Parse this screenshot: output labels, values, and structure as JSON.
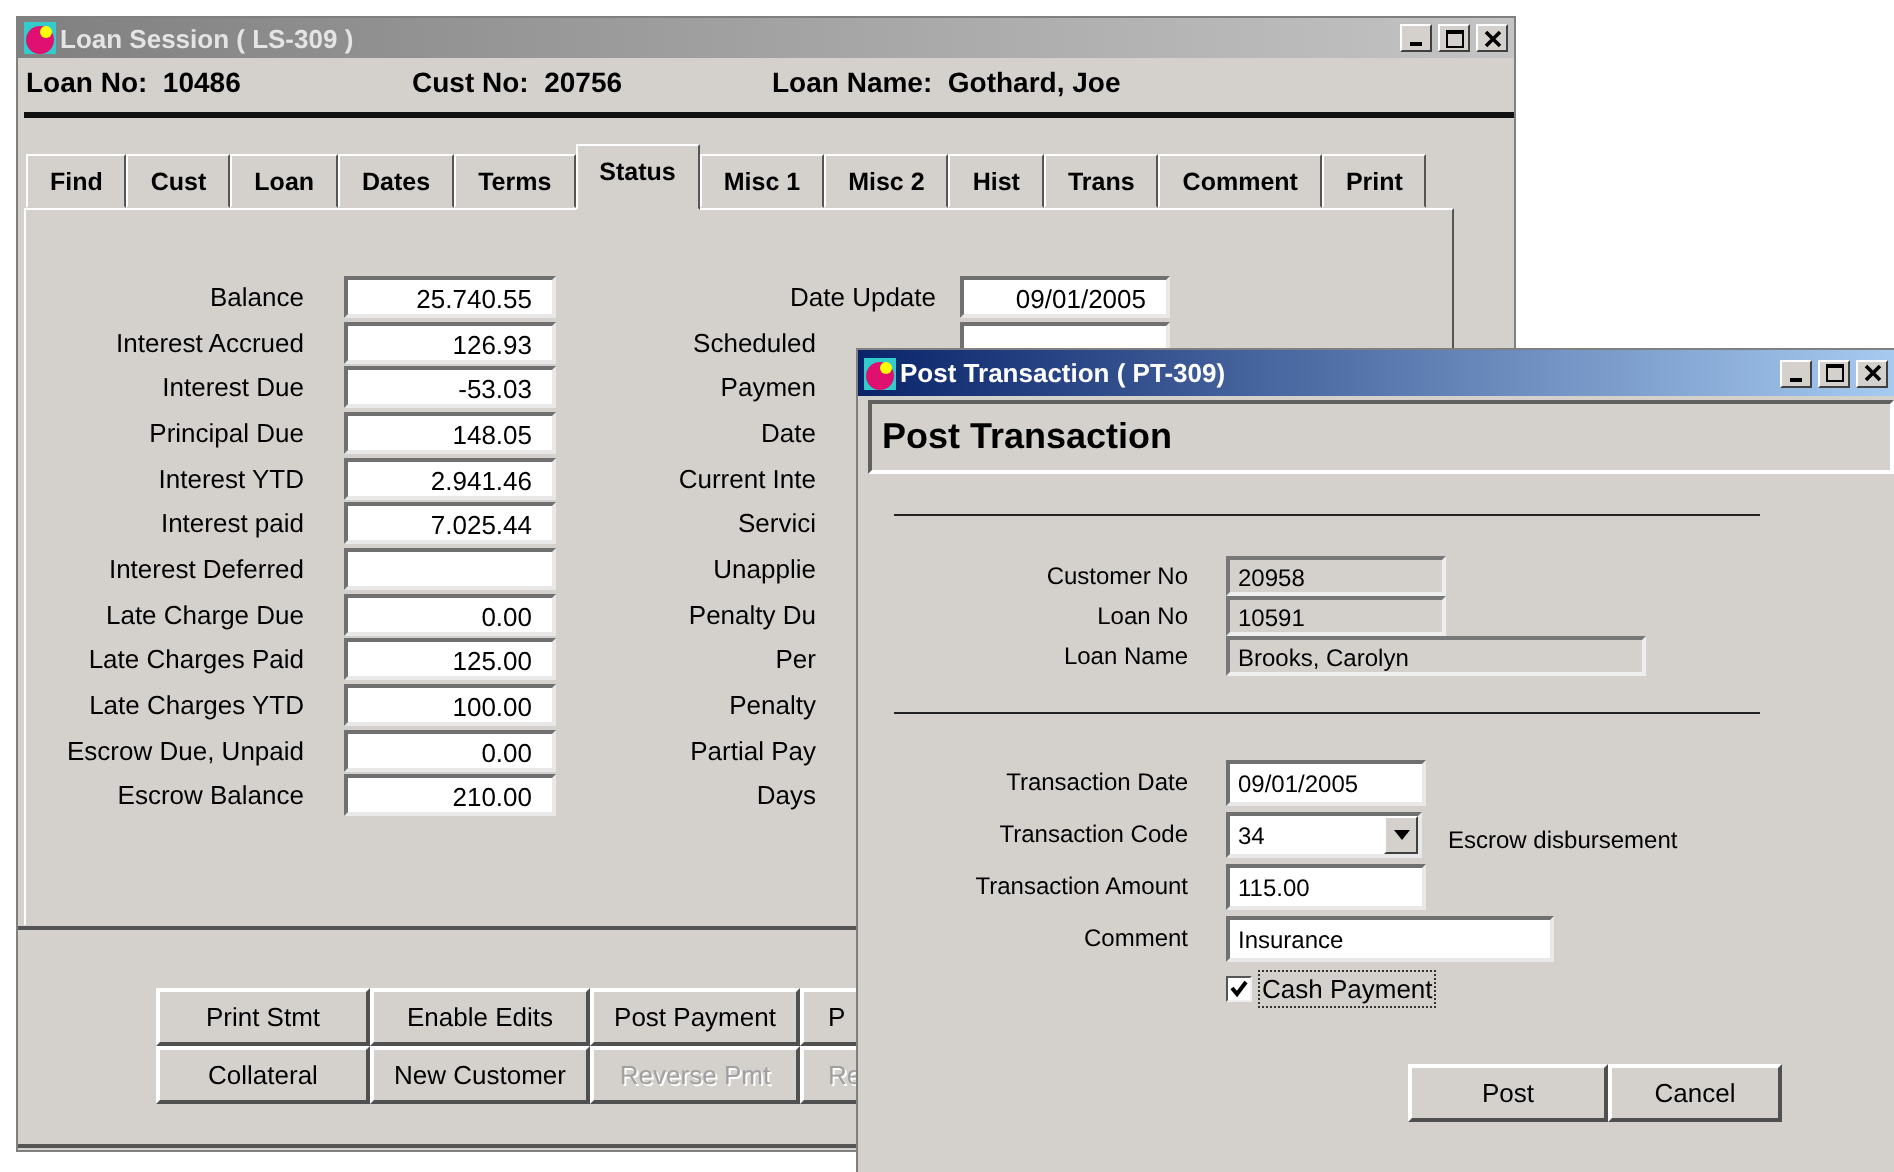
{
  "main_window": {
    "title": "Loan Session ( LS-309 )",
    "header": [
      {
        "label": "Loan No:",
        "value": "10486"
      },
      {
        "label": "Cust No:",
        "value": "20756"
      },
      {
        "label": "Loan Name:",
        "value": "Gothard, Joe"
      }
    ],
    "tabs": [
      {
        "label": "Find",
        "selected": false
      },
      {
        "label": "Cust",
        "selected": false
      },
      {
        "label": "Loan",
        "selected": false
      },
      {
        "label": "Dates",
        "selected": false
      },
      {
        "label": "Terms",
        "selected": false
      },
      {
        "label": "Status",
        "selected": true
      },
      {
        "label": "Misc 1",
        "selected": false
      },
      {
        "label": "Misc 2",
        "selected": false
      },
      {
        "label": "Hist",
        "selected": false
      },
      {
        "label": "Trans",
        "selected": false
      },
      {
        "label": "Comment",
        "selected": false
      },
      {
        "label": "Print",
        "selected": false
      }
    ],
    "fields_left": [
      {
        "label": "Balance",
        "value": "25.740.55"
      },
      {
        "label": "Interest Accrued",
        "value": "126.93"
      },
      {
        "label": "Interest Due",
        "value": "-53.03"
      },
      {
        "label": "Principal Due",
        "value": "148.05"
      },
      {
        "label": "Interest YTD",
        "value": "2.941.46"
      },
      {
        "label": "Interest paid",
        "value": "7.025.44"
      },
      {
        "label": "Interest Deferred"
      },
      {
        "label": "Late Charge Due",
        "value": "0.00"
      },
      {
        "label": "Late Charges Paid",
        "value": "125.00"
      },
      {
        "label": "Late Charges YTD",
        "value": "100.00"
      },
      {
        "label": "Escrow Due, Unpaid",
        "value": "0.00"
      },
      {
        "label": "Escrow Balance",
        "value": "210.00"
      }
    ],
    "fields_right": [
      {
        "kind": "field",
        "label": "Date Update",
        "value": "09/01/2005"
      },
      {
        "kind": "covered",
        "label": "Scheduled"
      },
      {
        "kind": "label",
        "label": "Paymen"
      },
      {
        "kind": "label",
        "label": "Date"
      },
      {
        "kind": "label",
        "label": "Current Inte"
      },
      {
        "kind": "label",
        "label": "Servici"
      },
      {
        "kind": "label",
        "label": "Unapplie"
      },
      {
        "kind": "label",
        "label": "Penalty Du"
      },
      {
        "kind": "label",
        "label": "Per"
      },
      {
        "kind": "label",
        "label": "Penalty"
      },
      {
        "kind": "label",
        "label": "Partial Pay"
      },
      {
        "kind": "label",
        "label": "Days"
      }
    ],
    "buttons": [
      [
        {
          "label": "Print Stmt",
          "disabled": false,
          "kind": "full"
        },
        {
          "label": "Enable Edits",
          "disabled": false,
          "kind": "full"
        },
        {
          "label": "Post Payment",
          "disabled": false,
          "kind": "full"
        },
        {
          "label": "P",
          "disabled": false,
          "kind": "partial"
        }
      ],
      [
        {
          "label": "Collateral",
          "disabled": false,
          "kind": "full"
        },
        {
          "label": "New Customer",
          "disabled": false,
          "kind": "full"
        },
        {
          "label": "Reverse Pmt",
          "disabled": true,
          "kind": "full"
        },
        {
          "label": "Re",
          "disabled": true,
          "kind": "partial"
        }
      ]
    ]
  },
  "dialog": {
    "title": "Post Transaction ( PT-309)",
    "heading": "Post Transaction",
    "info": [
      {
        "label": "Customer No",
        "value": "20958",
        "kind": "short"
      },
      {
        "label": "Loan No",
        "value": "10591",
        "kind": "short"
      },
      {
        "label": "Loan Name",
        "value": "Brooks, Carolyn",
        "kind": "long"
      }
    ],
    "form": [
      {
        "kind": "text",
        "label": "Transaction Date",
        "value": "09/01/2005"
      },
      {
        "kind": "dropdown",
        "label": "Transaction Code",
        "value": "34",
        "description": "Escrow disbursement"
      },
      {
        "kind": "text",
        "label": "Transaction Amount",
        "value": "115.00"
      },
      {
        "kind": "wide",
        "label": "Comment",
        "value": "Insurance"
      }
    ],
    "checkbox": {
      "label": "Cash Payment",
      "checked": true
    },
    "buttons": [
      "Post",
      "Cancel"
    ]
  }
}
